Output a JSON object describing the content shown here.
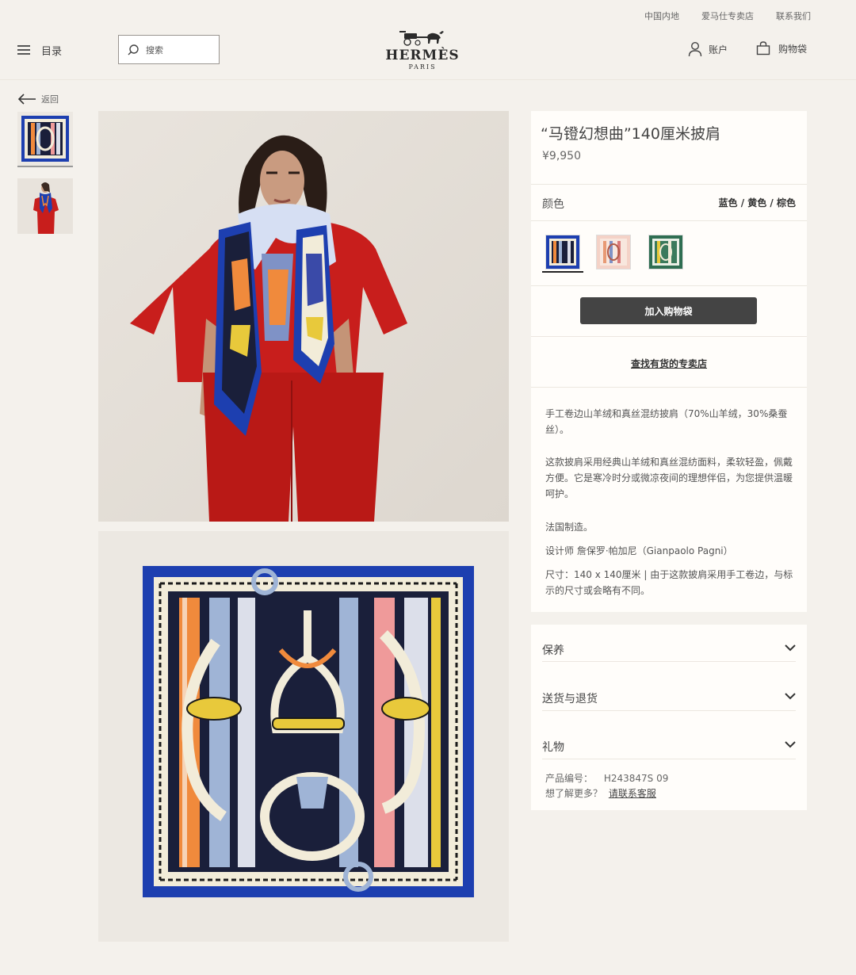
{
  "top_links": [
    "中国内地",
    "爱马仕专卖店",
    "联系我们"
  ],
  "header": {
    "menu_label": "目录",
    "search_placeholder": "搜索",
    "logo_word": "HERMÈS",
    "logo_sub": "PARIS",
    "account_label": "账户",
    "cart_label": "购物袋"
  },
  "back_label": "返回",
  "product": {
    "title": "“马镫幻想曲”140厘米披肩",
    "price": "¥9,950",
    "color_label": "颜色",
    "color_value": "蓝色 / 黄色 / 棕色",
    "add_to_bag": "加入购物袋",
    "find_store": "查找有货的专卖店",
    "desc1": "手工卷边山羊绒和真丝混纺披肩（70%山羊绒，30%桑蚕丝）。",
    "desc2": "这款披肩采用经典山羊绒和真丝混纺面料，柔软轻盈，佩戴方便。它是寒冷时分或微凉夜间的理想伴侣，为您提供温暖呵护。",
    "desc3": "法国制造。",
    "desc4": "设计师 詹保罗·帕加尼（Gianpaolo Pagni）",
    "desc5": "尺寸：140 x 140厘米 | 由于这款披肩采用手工卷边，与标示的尺寸或会略有不同。"
  },
  "accordion": [
    "保养",
    "送货与退货",
    "礼物"
  ],
  "product_meta": {
    "code_label": "产品编号：",
    "code_value": "H243847S 09",
    "more_label": "想了解更多？",
    "contact_link": "请联系客服"
  },
  "colors": {
    "scarf_blue": "#1d3fb0",
    "model_red": "#c81e1c",
    "button": "#444444",
    "background": "#f4f1ec"
  }
}
